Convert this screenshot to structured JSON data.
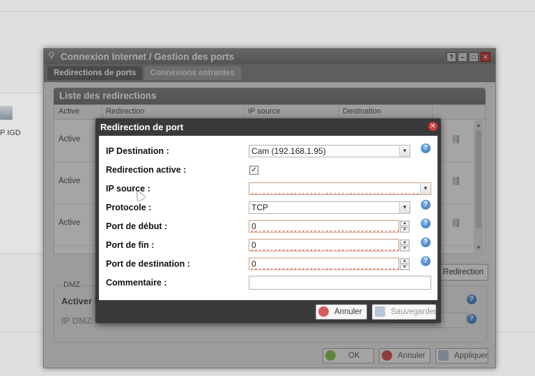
{
  "background": {
    "device_label": "P IGD"
  },
  "window": {
    "title": "Connexion Internet / Gestion des ports",
    "buttons": {
      "help": "?",
      "minimize": "–",
      "maximize": "□",
      "close": "✕"
    },
    "tabs": [
      {
        "label": "Redirections de ports",
        "active": true
      },
      {
        "label": "Connexions entrantes",
        "active": false
      }
    ],
    "list": {
      "title": "Liste des redirections",
      "columns": [
        "Active",
        "Redirection",
        "IP source",
        "Destination"
      ],
      "rows": [
        {
          "active": "Active"
        },
        {
          "active": "Active"
        },
        {
          "active": "Active"
        }
      ]
    },
    "add_redirect_label": "Redirection",
    "dmz": {
      "legend": "DMZ",
      "activer_label": "Activer l",
      "ip_label": "IP DMZ"
    },
    "footer": {
      "ok": "OK",
      "cancel": "Annuler",
      "apply": "Appliquer"
    }
  },
  "dialog": {
    "title": "Redirection de port",
    "close": "✕",
    "fields": {
      "ip_destination": {
        "label": "IP Destination :",
        "value": "Cam (192.168.1.95)"
      },
      "redirection_active": {
        "label": "Redirection active :",
        "checked": "✓"
      },
      "ip_source": {
        "label": "IP source :",
        "value": ""
      },
      "protocole": {
        "label": "Protocole :",
        "value": "TCP"
      },
      "port_debut": {
        "label": "Port de début :",
        "value": "0"
      },
      "port_fin": {
        "label": "Port de fin :",
        "value": "0"
      },
      "port_destination": {
        "label": "Port de destination :",
        "value": "0"
      },
      "commentaire": {
        "label": "Commentaire :",
        "value": ""
      }
    },
    "buttons": {
      "cancel": "Annuler",
      "save": "Sauvegarder"
    }
  },
  "icons": {
    "help": "help-icon",
    "dropdown": "chevron-down-icon"
  }
}
